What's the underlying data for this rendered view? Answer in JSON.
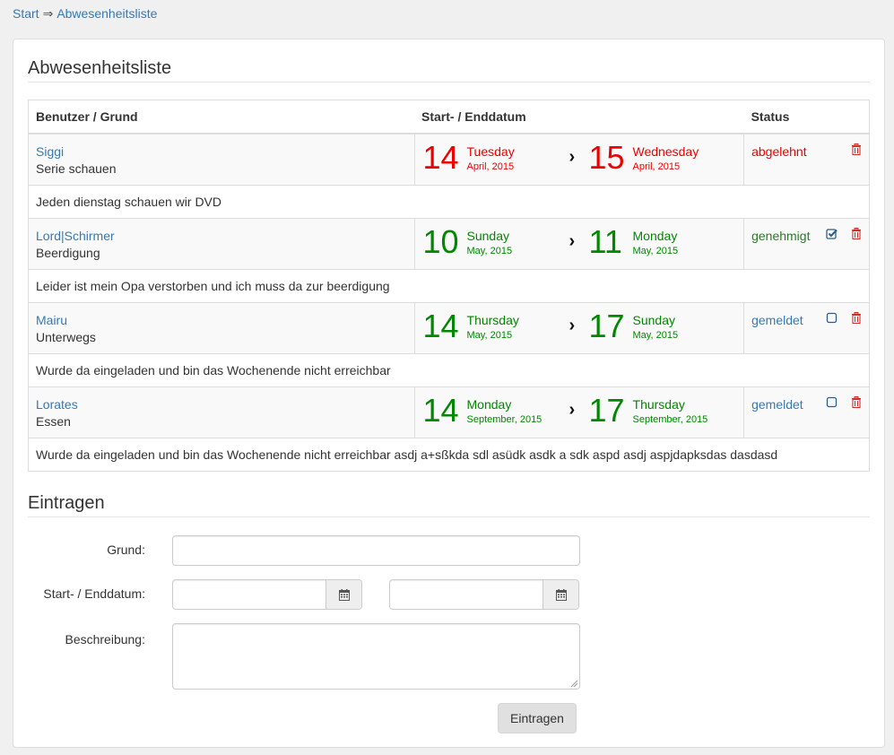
{
  "breadcrumb": {
    "home": "Start",
    "separator": "⇒",
    "current": "Abwesenheitsliste"
  },
  "list": {
    "title": "Abwesenheitsliste",
    "headers": {
      "user": "Benutzer / Grund",
      "dates": "Start- / Enddatum",
      "status": "Status"
    },
    "rows": [
      {
        "user": "Siggi",
        "reason": "Serie schauen",
        "start": {
          "day": "14",
          "weekday": "Tuesday",
          "month": "April, 2015"
        },
        "end": {
          "day": "15",
          "weekday": "Wednesday",
          "month": "April, 2015"
        },
        "status": "abgelehnt",
        "description": "Jeden dienstag schauen wir DVD"
      },
      {
        "user": "Lord|Schirmer",
        "reason": "Beerdigung",
        "start": {
          "day": "10",
          "weekday": "Sunday",
          "month": "May, 2015"
        },
        "end": {
          "day": "11",
          "weekday": "Monday",
          "month": "May, 2015"
        },
        "status": "genehmigt",
        "description": "Leider ist mein Opa verstorben und ich muss da zur beerdigung"
      },
      {
        "user": "Mairu",
        "reason": "Unterwegs",
        "start": {
          "day": "14",
          "weekday": "Thursday",
          "month": "May, 2015"
        },
        "end": {
          "day": "17",
          "weekday": "Sunday",
          "month": "May, 2015"
        },
        "status": "gemeldet",
        "description": "Wurde da eingeladen und bin das Wochenende nicht erreichbar"
      },
      {
        "user": "Lorates",
        "reason": "Essen",
        "start": {
          "day": "14",
          "weekday": "Monday",
          "month": "September, 2015"
        },
        "end": {
          "day": "17",
          "weekday": "Thursday",
          "month": "September, 2015"
        },
        "status": "gemeldet",
        "description": "Wurde da eingeladen und bin das Wochenende nicht erreichbar asdj a+sßkda sdl asüdk asdk a sdk aspd asdj aspjdapksdas dasdasd"
      }
    ]
  },
  "form": {
    "title": "Eintragen",
    "reason_label": "Grund:",
    "reason_value": "",
    "dates_label": "Start- / Enddatum:",
    "start_value": "",
    "end_value": "",
    "description_label": "Beschreibung:",
    "description_value": "",
    "submit_label": "Eintragen"
  },
  "colors": {
    "link": "#337ab7",
    "rejected": "#e00000",
    "approved": "#2a7a2a",
    "date_red": "#e00000",
    "date_green": "#008000",
    "delete_icon": "#c9302c"
  },
  "icons": {
    "delete": "trash-icon",
    "approved": "checked-box-icon",
    "pending": "empty-box-icon",
    "calendar": "calendar-icon"
  }
}
